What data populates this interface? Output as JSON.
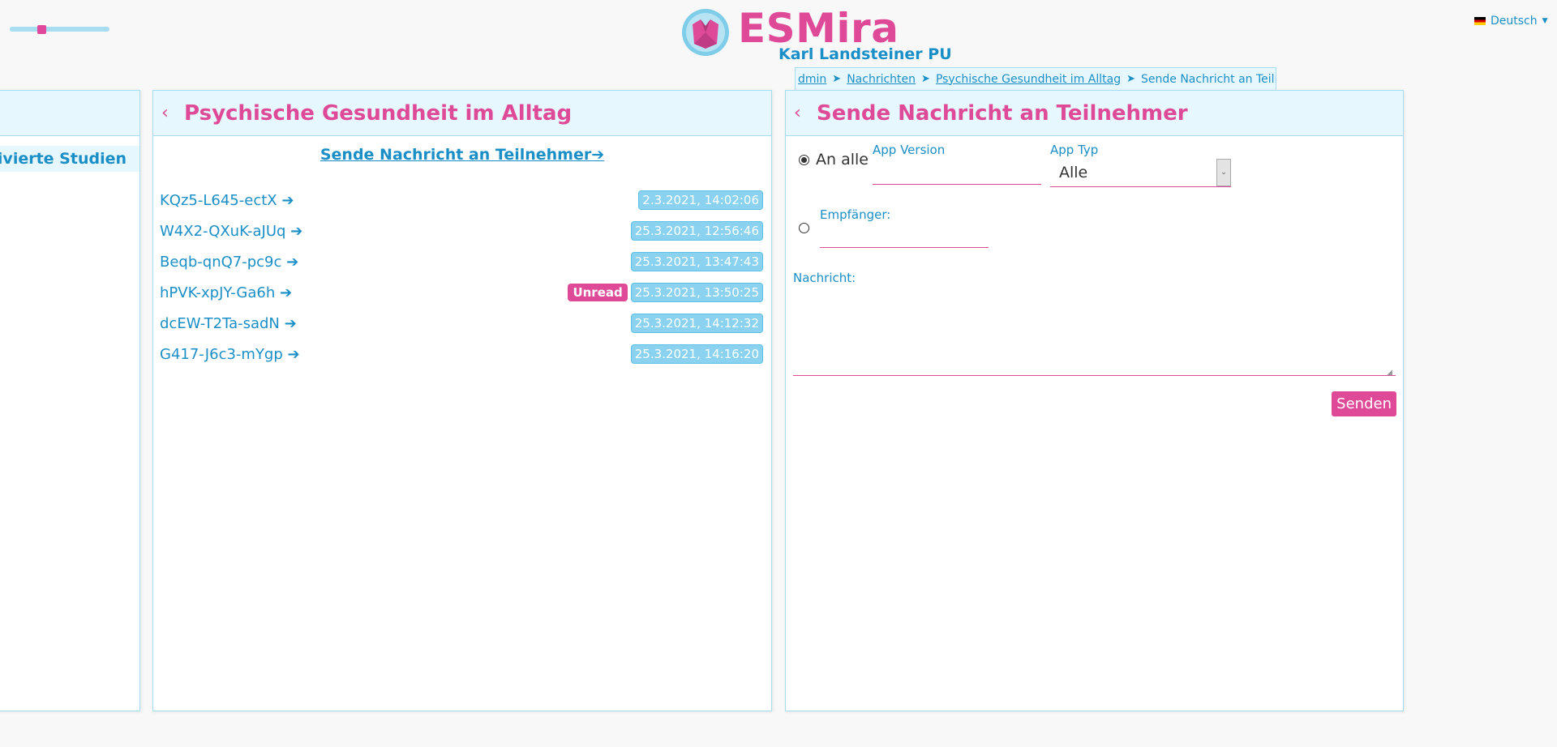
{
  "header": {
    "app_title": "ESMira",
    "org_name": "Karl Landsteiner PU",
    "language": "Deutsch"
  },
  "zoom_slider": {
    "value_fraction": 0.3
  },
  "breadcrumb": {
    "items": [
      "dmin",
      "Nachrichten",
      "Psychische Gesundheit im Alltag"
    ],
    "current": "Sende Nachricht an Teilnehmer"
  },
  "left_panel": {
    "nav_item": "ktivierte Studien"
  },
  "middle_panel": {
    "title": "Psychische Gesundheit im Alltag",
    "send_link": "Sende Nachricht an Teilnehmer➔",
    "conversations": [
      {
        "id": "KQz5-L645-ectX ➔",
        "timestamp": "2.3.2021, 14:02:06",
        "unread": ""
      },
      {
        "id": "W4X2-QXuK-aJUq ➔",
        "timestamp": "25.3.2021, 12:56:46",
        "unread": ""
      },
      {
        "id": "Beqb-qnQ7-pc9c ➔",
        "timestamp": "25.3.2021, 13:47:43",
        "unread": ""
      },
      {
        "id": "hPVK-xpJY-Ga6h ➔",
        "timestamp": "25.3.2021, 13:50:25",
        "unread": "Unread"
      },
      {
        "id": "dcEW-T2Ta-sadN ➔",
        "timestamp": "25.3.2021, 14:12:32",
        "unread": ""
      },
      {
        "id": "G417-J6c3-mYgp ➔",
        "timestamp": "25.3.2021, 14:16:20",
        "unread": ""
      }
    ]
  },
  "right_panel": {
    "title": "Sende Nachricht an Teilnehmer",
    "radio_all_label": "An alle",
    "app_version_label": "App Version",
    "app_version_value": "",
    "app_type_label": "App Typ",
    "app_type_value": "Alle",
    "recipient_label": "Empfänger:",
    "recipient_value": "",
    "message_label": "Nachricht:",
    "message_value": "",
    "send_button": "Senden",
    "selected_radio": "all"
  },
  "colors": {
    "accent_pink": "#de4a97",
    "accent_blue": "#1a8fc7",
    "panel_header_bg": "#e6f7fd",
    "timestamp_bg": "#8ad2ef"
  }
}
